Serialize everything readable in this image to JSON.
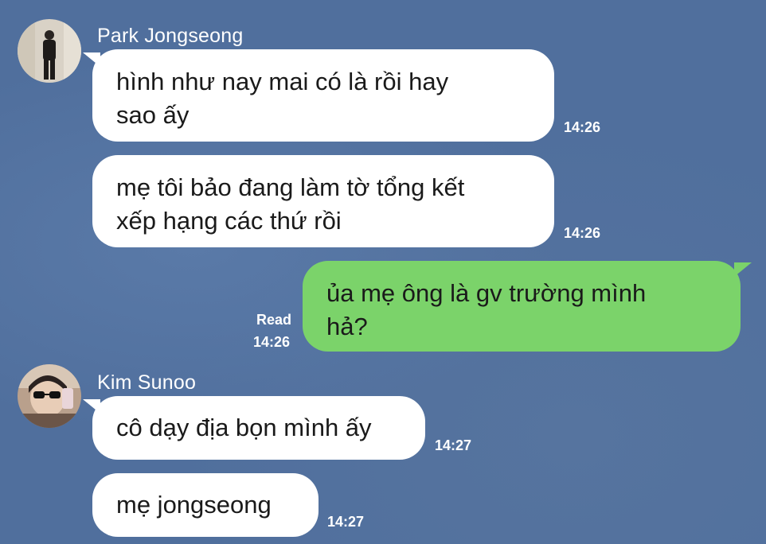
{
  "theme": {
    "background": "#506f9d",
    "incoming_bubble": "#ffffff",
    "outgoing_bubble": "#7bd36a",
    "meta_text": "#ffffff"
  },
  "conversation": {
    "groups": [
      {
        "sender": "Park Jongseong",
        "avatar_icon": "profile-photo-standing-person",
        "messages": [
          {
            "text_line1": "hình như nay mai có là rồi hay",
            "text_line2": "sao ấy",
            "time": "14:26"
          },
          {
            "text_line1": "mẹ tôi bảo đang làm tờ tổng kết",
            "text_line2": "xếp hạng các thứ rồi",
            "time": "14:26"
          }
        ]
      },
      {
        "sender": "me",
        "messages": [
          {
            "text_line1": "ủa mẹ ông là gv trường mình",
            "text_line2": "hả?",
            "read": "Read",
            "time": "14:26"
          }
        ]
      },
      {
        "sender": "Kim Sunoo",
        "avatar_icon": "profile-photo-sunglasses",
        "messages": [
          {
            "text_line1": "cô dạy địa bọn mình ấy",
            "time": "14:27"
          },
          {
            "text_line1": "mẹ jongseong",
            "time": "14:27"
          }
        ]
      }
    ]
  }
}
